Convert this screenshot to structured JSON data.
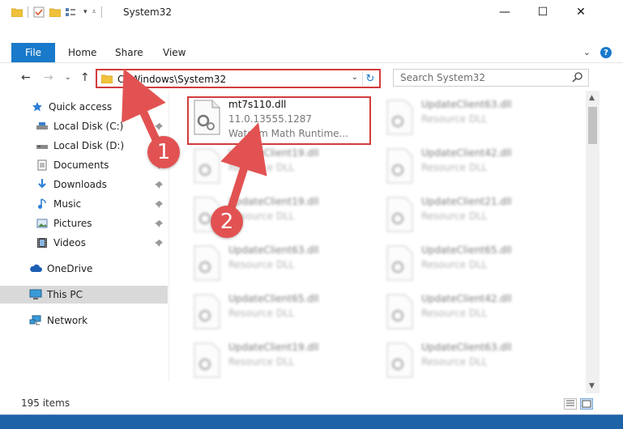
{
  "window": {
    "title": "System32",
    "controls": {
      "minimize": "—",
      "maximize": "☐",
      "close": "✕"
    }
  },
  "ribbon": {
    "tabs": [
      "File",
      "Home",
      "Share",
      "View"
    ],
    "help": "?"
  },
  "address_bar": {
    "path": "C:\\Windows\\System32",
    "search_placeholder": "Search System32"
  },
  "sidebar": {
    "items": [
      {
        "label": "Quick access",
        "icon": "star-icon",
        "pinned": false
      },
      {
        "label": "Local Disk (C:)",
        "icon": "drive-icon",
        "pinned": true
      },
      {
        "label": "Local Disk (D:)",
        "icon": "drive-icon",
        "pinned": true
      },
      {
        "label": "Documents",
        "icon": "document-icon",
        "pinned": true
      },
      {
        "label": "Downloads",
        "icon": "download-icon",
        "pinned": true
      },
      {
        "label": "Music",
        "icon": "music-icon",
        "pinned": true
      },
      {
        "label": "Pictures",
        "icon": "pictures-icon",
        "pinned": true
      },
      {
        "label": "Videos",
        "icon": "videos-icon",
        "pinned": true
      },
      {
        "label": "OneDrive",
        "icon": "cloud-icon",
        "pinned": false
      },
      {
        "label": "This PC",
        "icon": "computer-icon",
        "pinned": false,
        "selected": true
      },
      {
        "label": "Network",
        "icon": "network-icon",
        "pinned": false
      }
    ]
  },
  "files": {
    "highlighted": {
      "name": "mt7s110.dll",
      "version": "11.0.13555.1287",
      "description": "Watcom Math Runtime..."
    },
    "blurred": [
      {
        "name": "UpdateClient63.dll",
        "type": "Resource DLL"
      },
      {
        "name": "UpdateClient19.dll",
        "type": "Resource DLL"
      },
      {
        "name": "UpdateClient42.dll",
        "type": "Resource DLL"
      },
      {
        "name": "UpdateClient19.dll",
        "type": "Resource DLL"
      },
      {
        "name": "UpdateClient21.dll",
        "type": "Resource DLL"
      },
      {
        "name": "UpdateClient63.dll",
        "type": "Resource DLL"
      },
      {
        "name": "UpdateClient65.dll",
        "type": "Resource DLL"
      },
      {
        "name": "UpdateClient65.dll",
        "type": "Resource DLL"
      },
      {
        "name": "UpdateClient42.dll",
        "type": "Resource DLL"
      },
      {
        "name": "UpdateClient19.dll",
        "type": "Resource DLL"
      },
      {
        "name": "UpdateClient63.dll",
        "type": "Resource DLL"
      }
    ]
  },
  "status": {
    "item_count": "195 items"
  },
  "callouts": [
    "1",
    "2"
  ],
  "colors": {
    "accent": "#1979ca",
    "highlight_border": "#d23c3c",
    "callout": "#e25252",
    "selected_nav": "#d9d9d9"
  }
}
